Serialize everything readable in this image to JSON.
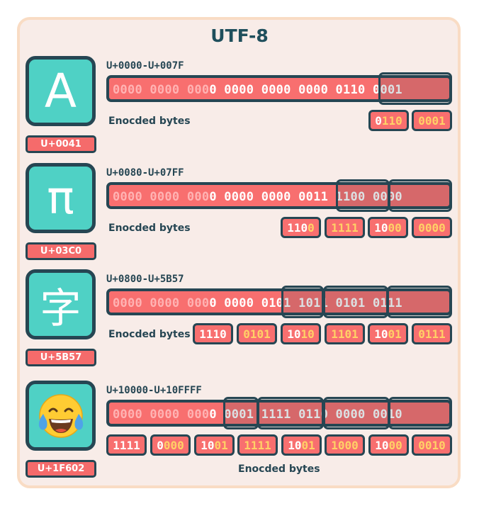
{
  "title": "UTF-8",
  "encoded_label": "Enocded bytes",
  "rows": [
    {
      "glyph": "A",
      "code_point": "U+0041",
      "range": "U+0000-U+007F",
      "pad_bits": "0000 0000 000",
      "value_bits": "0 0000 0000 0000 0110 0001",
      "bytes": [
        {
          "header": "0",
          "payload": "110"
        },
        {
          "header": "",
          "payload": "0001"
        }
      ]
    },
    {
      "glyph": "π",
      "code_point": "U+03C0",
      "range": "U+0080-U+07FF",
      "pad_bits": "0000 0000 000",
      "value_bits": "0 0000 0000 0011 1100 0000",
      "bytes": [
        {
          "header": "110",
          "payload": "0"
        },
        {
          "header": "",
          "payload": "1111"
        },
        {
          "header": "10",
          "payload": "00"
        },
        {
          "header": "",
          "payload": "0000"
        }
      ]
    },
    {
      "glyph": "字",
      "code_point": "U+5B57",
      "range": "U+0800-U+5B57",
      "pad_bits": "0000 0000 000",
      "value_bits": "0 0000 0101 1011 0101 0111",
      "bytes": [
        {
          "header": "1110",
          "payload": ""
        },
        {
          "header": "",
          "payload": "0101"
        },
        {
          "header": "10",
          "payload": "10"
        },
        {
          "header": "",
          "payload": "1101"
        },
        {
          "header": "10",
          "payload": "01"
        },
        {
          "header": "",
          "payload": "0111"
        }
      ]
    },
    {
      "glyph": "😂",
      "code_point": "U+1F602",
      "range": "U+10000-U+10FFFF",
      "pad_bits": "0000 0000 000",
      "value_bits": "0 0001 1111 0110 0000 0010",
      "bytes": [
        {
          "header": "1111",
          "payload": ""
        },
        {
          "header": "0",
          "payload": "000"
        },
        {
          "header": "10",
          "payload": "01"
        },
        {
          "header": "",
          "payload": "1111"
        },
        {
          "header": "10",
          "payload": "01"
        },
        {
          "header": "",
          "payload": "1000"
        },
        {
          "header": "10",
          "payload": "00"
        },
        {
          "header": "",
          "payload": "0010"
        }
      ]
    }
  ]
}
